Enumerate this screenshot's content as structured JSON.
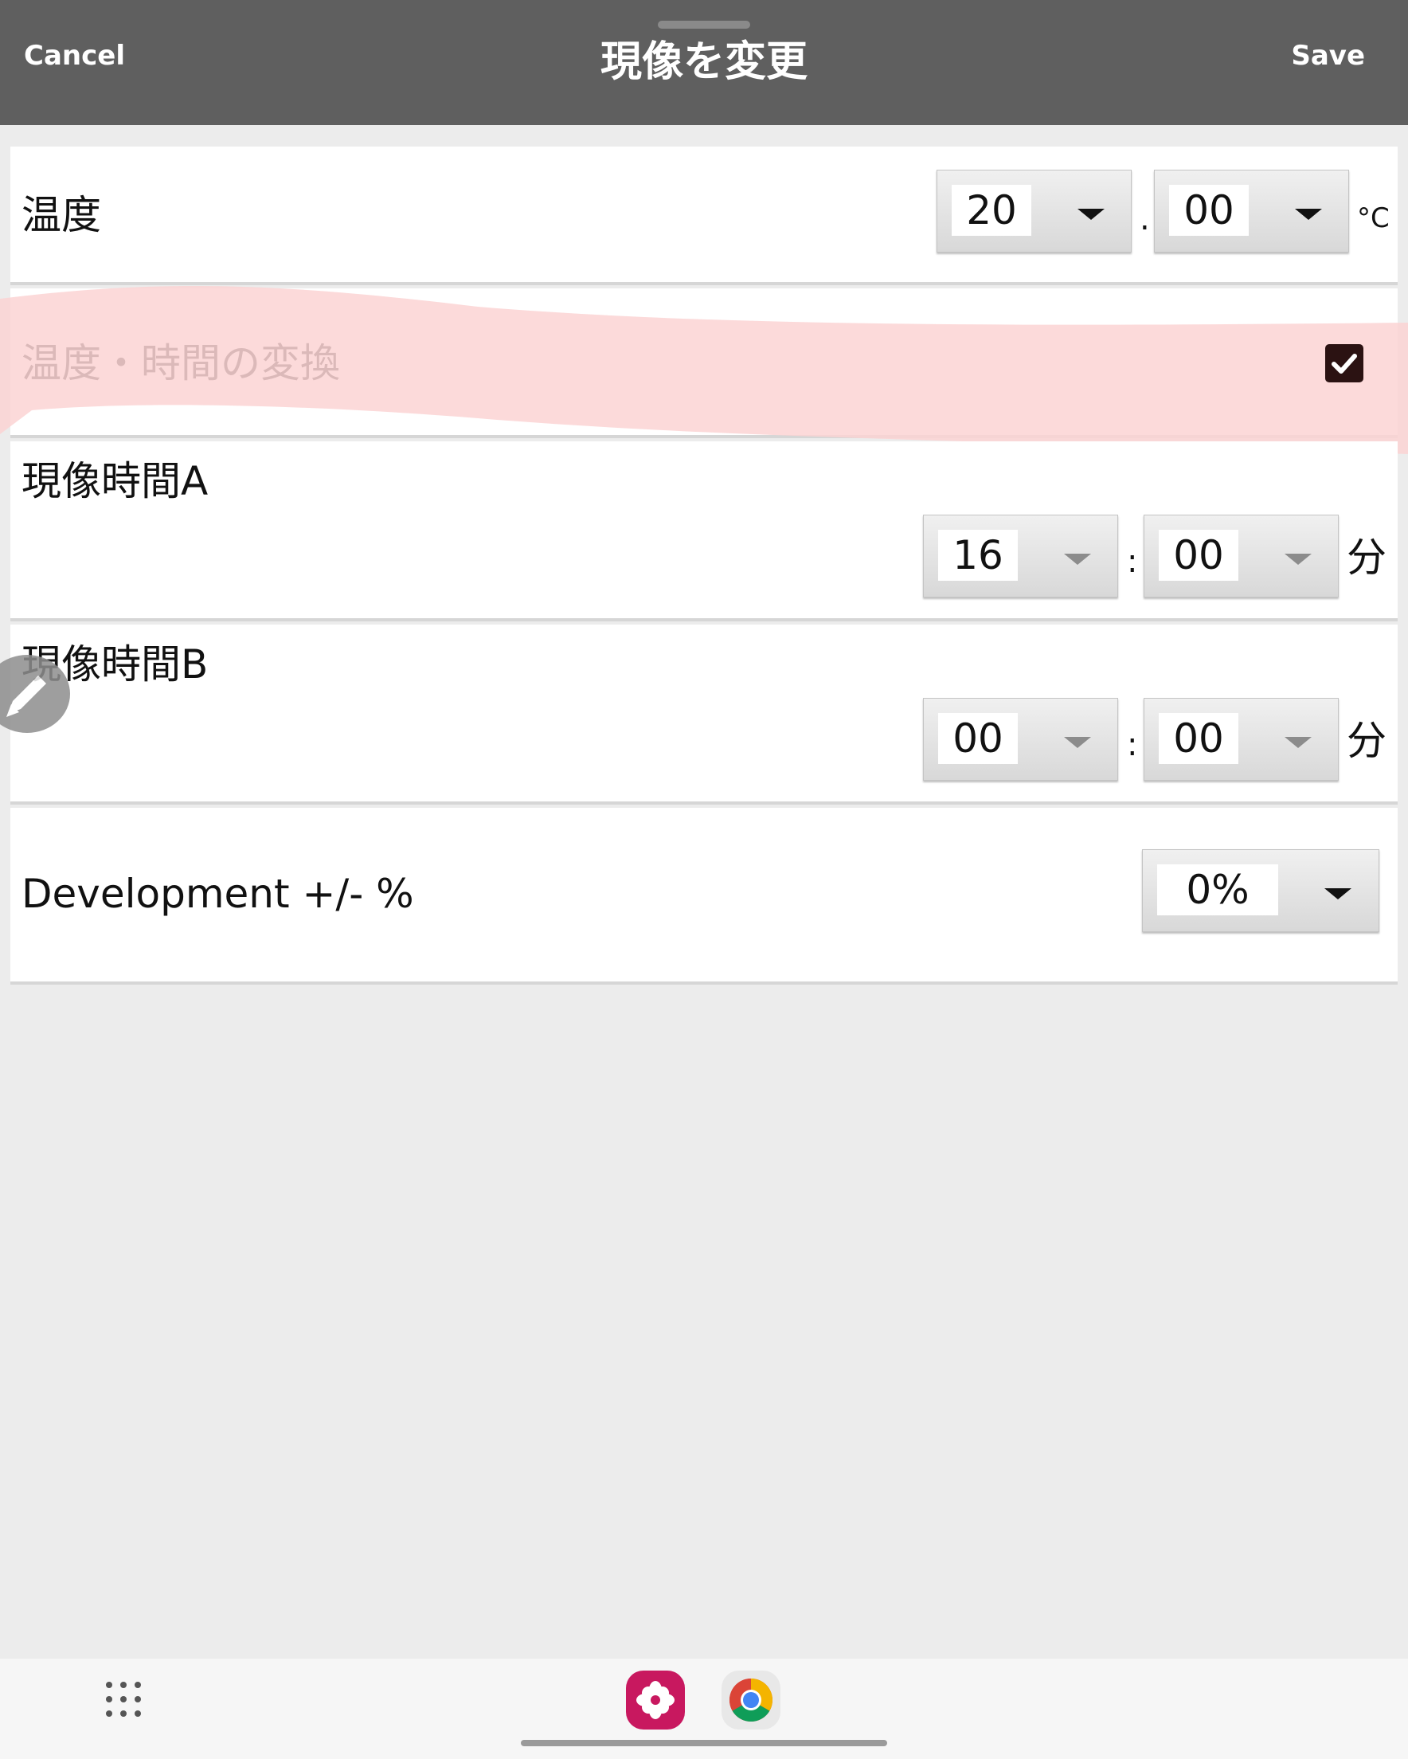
{
  "header": {
    "cancel_label": "Cancel",
    "title": "現像を変更",
    "save_label": "Save"
  },
  "temperature": {
    "label": "温度",
    "whole_value": "20",
    "separator": ".",
    "fraction_value": "00",
    "unit": "°C"
  },
  "conversion": {
    "label": "温度・時間の変換",
    "checked": true
  },
  "dev_time_a": {
    "label": "現像時間A",
    "minutes_value": "16",
    "separator": ":",
    "seconds_value": "00",
    "unit": "分"
  },
  "dev_time_b": {
    "label": "現像時間B",
    "minutes_value": "00",
    "separator": ":",
    "seconds_value": "00",
    "unit": "分"
  },
  "development": {
    "label": "Development +/- %",
    "value": "0%"
  },
  "colors": {
    "header_bg": "#5f5f5f",
    "page_bg": "#ececec",
    "highlight": "#fbd3d3",
    "checkbox": "#2b1212",
    "gallery_app": "#c8185f"
  },
  "navbar": {
    "icons": [
      "apps-grid-icon",
      "gallery-app-icon",
      "chrome-app-icon"
    ]
  }
}
